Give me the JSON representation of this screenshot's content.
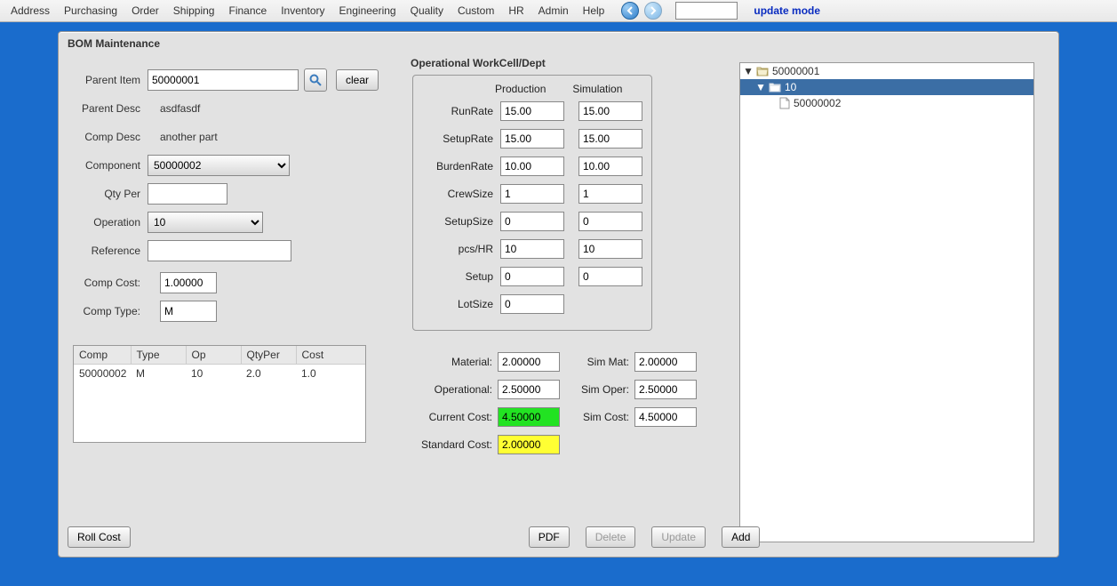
{
  "menubar": {
    "items": [
      "Address",
      "Purchasing",
      "Order",
      "Shipping",
      "Finance",
      "Inventory",
      "Engineering",
      "Quality",
      "Custom",
      "HR",
      "Admin",
      "Help"
    ],
    "search_value": "",
    "mode_label": "update mode"
  },
  "panel": {
    "title": "BOM Maintenance"
  },
  "form": {
    "labels": {
      "parent_item": "Parent Item",
      "parent_desc": "Parent Desc",
      "comp_desc": "Comp Desc",
      "component": "Component",
      "qty_per": "Qty Per",
      "operation": "Operation",
      "reference": "Reference",
      "comp_cost": "Comp Cost:",
      "comp_type": "Comp Type:"
    },
    "parent_item": "50000001",
    "parent_desc_value": "asdfasdf",
    "comp_desc_value": "another part",
    "component_value": "50000002",
    "qty_per_value": "",
    "operation_value": "10",
    "reference_value": "",
    "comp_cost_value": "1.00000",
    "comp_type_value": "M",
    "clear_label": "clear"
  },
  "ops": {
    "title": "Operational WorkCell/Dept",
    "head": {
      "prod": "Production",
      "sim": "Simulation"
    },
    "rows": [
      {
        "label": "RunRate",
        "p": "15.00",
        "s": "15.00"
      },
      {
        "label": "SetupRate",
        "p": "15.00",
        "s": "15.00"
      },
      {
        "label": "BurdenRate",
        "p": "10.00",
        "s": "10.00"
      },
      {
        "label": "CrewSize",
        "p": "1",
        "s": "1"
      },
      {
        "label": "SetupSize",
        "p": "0",
        "s": "0"
      },
      {
        "label": "pcs/HR",
        "p": "10",
        "s": "10"
      },
      {
        "label": "Setup",
        "p": "0",
        "s": "0"
      }
    ],
    "lotsize": {
      "label": "LotSize",
      "value": "0"
    }
  },
  "costs": {
    "labels": {
      "material": "Material:",
      "operational": "Operational:",
      "current": "Current Cost:",
      "standard": "Standard Cost:",
      "sim_mat": "Sim Mat:",
      "sim_oper": "Sim Oper:",
      "sim_cost": "Sim Cost:"
    },
    "material": "2.00000",
    "operational": "2.50000",
    "current": "4.50000",
    "standard": "2.00000",
    "sim_mat": "2.00000",
    "sim_oper": "2.50000",
    "sim_cost": "4.50000"
  },
  "grid": {
    "headers": [
      "Comp",
      "Type",
      "Op",
      "QtyPer",
      "Cost"
    ],
    "rows": [
      {
        "comp": "50000002",
        "type": "M",
        "op": "10",
        "qty": "2.0",
        "cost": "1.0"
      }
    ]
  },
  "buttons": {
    "roll_cost": "Roll Cost",
    "pdf": "PDF",
    "delete": "Delete",
    "update": "Update",
    "add": "Add"
  },
  "tree": {
    "node0": "50000001",
    "node1": "10",
    "node2": "50000002"
  }
}
